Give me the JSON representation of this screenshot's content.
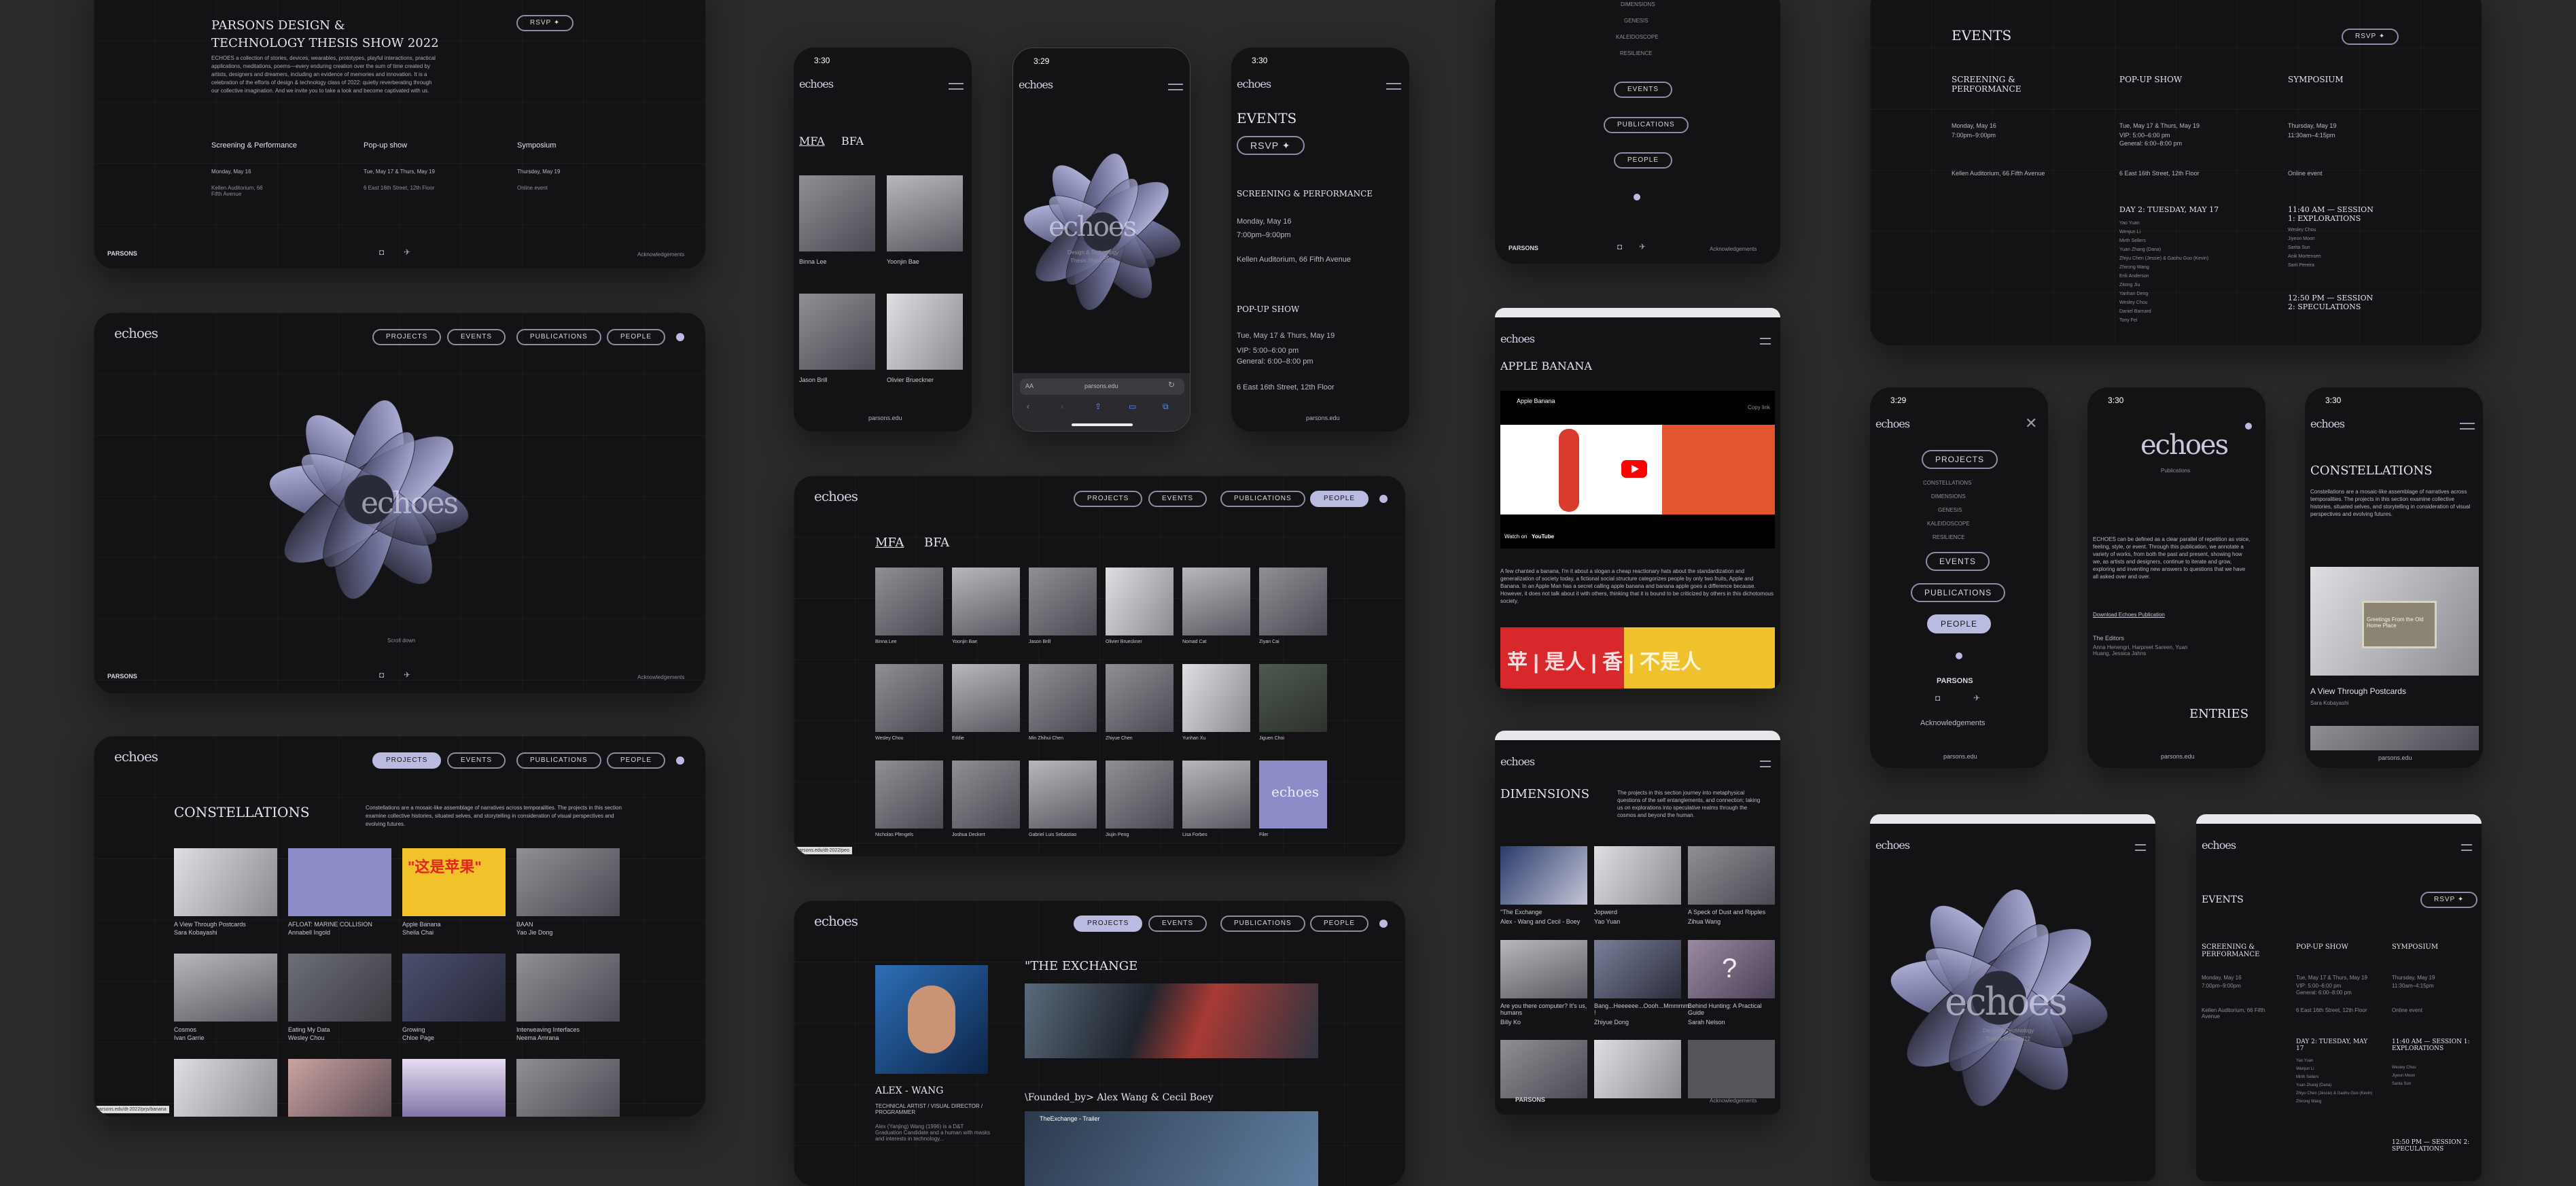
{
  "brand": {
    "logo": "echoes",
    "parsons": "PARSONS",
    "ack": "Acknowledgements",
    "url": "parsons.edu"
  },
  "nav": {
    "projects": "PROJECTS",
    "events": "EVENTS",
    "publications": "PUBLICATIONS",
    "people": "PEOPLE"
  },
  "colors": {
    "bg": "#2a2a2b",
    "frame": "#131315",
    "accent": "#b9bce0"
  },
  "f1": {
    "title": "PARSONS DESIGN & TECHNOLOGY THESIS SHOW 2022",
    "rsvp": "RSVP ✦",
    "para": "ECHOES a collection of stories, devices, wearables, prototypes, playful interactions, practical applications, meditations, poems—every enduring creation over the sum of time created by artists, designers and dreamers, including an evidence of memories and innovation. It is a celebration of the efforts of design & technology class of 2022: quietly reverberating through our collective imagination. And we invite you to take a look and become captivated with us.",
    "cols": [
      {
        "h": "Screening & Performance",
        "d": "Monday, May 16",
        "p": "Kellen Auditorium, 66 Fifth Avenue"
      },
      {
        "h": "Pop-up show",
        "d": "Tue, May 17 & Thurs, May 19",
        "p": "6 East 16th Street, 12th Floor"
      },
      {
        "h": "Symposium",
        "d": "Thursday, May 19",
        "p": "Online event"
      }
    ]
  },
  "f2": {
    "scroll": "Scroll down"
  },
  "f3": {
    "title": "CONSTELLATIONS",
    "desc": "Constellations are a mosaic-like assemblage of narratives across temporalities. The projects in this section examine collective histories, situated selves, and storytelling in consideration of visual perspectives and evolving futures.",
    "items": [
      {
        "t": "A View Through Postcards",
        "a": "Sara Kobayashi"
      },
      {
        "t": "AFLOAT: MARINE COLLISION",
        "a": "Annabell Ingold"
      },
      {
        "t": "Apple Banana",
        "a": "Sheila Chai"
      },
      {
        "t": "BAAN",
        "a": "Yao Jie Dong"
      },
      {
        "t": "Cosmos",
        "a": "Ivan Garrie"
      },
      {
        "t": "Eating My Data",
        "a": "Wesley Chou"
      },
      {
        "t": "Growing",
        "a": "Chloe Page"
      },
      {
        "t": "Interweaving Interfaces",
        "a": "Neema Amrana"
      }
    ],
    "poster": "\"这是苹果\"",
    "status": "parsons.edu/dt-2022/prjs/banana"
  },
  "f4": {
    "time": "3:30",
    "tabs": [
      "MFA",
      "BFA"
    ],
    "people": [
      "Binna Lee",
      "Yoonjin Bae",
      "Jason Brill",
      "Olivier Brueckner"
    ]
  },
  "f5": {
    "time": "3:29",
    "sub1": "Design & Technology",
    "sub2": "Thesis Show 2022",
    "aa": "AA",
    "url": "parsons.edu"
  },
  "f6": {
    "time": "3:30",
    "title": "EVENTS",
    "rsvp": "RSVP ✦",
    "sp": "SCREENING & PERFORMANCE",
    "spd": "Monday, May 16",
    "spt": "7:00pm–9:00pm",
    "spp": "Kellen Auditorium, 66 Fifth Avenue",
    "pu": "POP-UP SHOW",
    "pud": "Tue, May 17 & Thurs, May 19",
    "put1": "VIP: 5:00–6:00 pm",
    "put2": "General: 6:00–8:00 pm",
    "pup": "6 East 16th Street, 12th Floor"
  },
  "f7": {
    "tabs": [
      "MFA",
      "BFA"
    ],
    "names": [
      "Binna Lee",
      "Yoonjin Bae",
      "Jason Brill",
      "Olivier Brueckner",
      "Nomad Cat",
      "Ziyan Cai",
      "Wesley Chou",
      "Eddie",
      "Min Zhihui Chen",
      "Zhiyue Chen",
      "Yunhan Xu",
      "Jiguen Choi",
      "Nicholas Pfengels",
      "Joshua Deckert",
      "Gabriel Luis Sebastiao",
      "Jiujin Peng",
      "Lisa Forbes",
      "Filer"
    ],
    "status": "parsons.edu/dt-2022/peo"
  },
  "f8": {
    "name": "ALEX - WANG",
    "role": "TECHNICAL ARTIST / VISUAL DIRECTOR / PROGRAMMER",
    "bio": "Alex (Yanjing) Wang (1996) is a D&T Graduation Candidate and a human with masks and interests in technology...",
    "title": "\"THE EXCHANGE",
    "sub": "\\Founded_by> Alex Wang & Cecil Boey",
    "video": "TheExchange - Trailer"
  },
  "f9": {
    "items": [
      "DIMENSIONS",
      "GENESIS",
      "KALEIDOSCOPE",
      "RESILIENCE"
    ],
    "events": "EVENTS",
    "pubs": "PUBLICATIONS",
    "people": "PEOPLE"
  },
  "f10": {
    "title": "APPLE BANANA",
    "yt": "Apple Banana",
    "copy": "Copy link",
    "watch": "Watch on",
    "youtube": "YouTube",
    "desc": "A few chanted a banana, I'm it about a slogan a cheap reactionary hats about the standardization and generalization of society today, a fictional social structure categorizes people by only two fruits, Apple and Banana. In an Apple Man has a secret calling apple banana and banana apple goes a difference because. However, it does not talk about it with others, thinking that it is bound to be criticized by others in this dichotomous society.",
    "poster": "苹 | 是人 | 香 | 不是人"
  },
  "f11": {
    "title": "DIMENSIONS",
    "desc": "The projects in this section journey into metaphysical questions of the self entanglements, and connection; taking us on explorations into speculative realms through the cosmos and beyond the human.",
    "items": [
      {
        "t": "\"The Exchange",
        "a": "Alex - Wang and Cecil - Boey"
      },
      {
        "t": "Jopwerd",
        "a": "Yao Yuan"
      },
      {
        "t": "A Speck of Dust and Ripples",
        "a": "Zihua Wang"
      },
      {
        "t": "Are you there computer? It's us, humans",
        "a": "Billy Ko"
      },
      {
        "t": "Bang...Heeeeee...Oooh...Mmmmm !",
        "a": "Zhiyue Dong"
      },
      {
        "t": "Behind Hunting: A Practical Guide",
        "a": "Sarah Nelson"
      }
    ]
  },
  "f12": {
    "title": "EVENTS",
    "rsvp": "RSVP ✦",
    "c1": "SCREENING & PERFORMANCE",
    "c2": "POP-UP SHOW",
    "c3": "SYMPOSIUM",
    "d1": "Monday, May 16",
    "t1": "7:00pm–9:00pm",
    "p1": "Kellen Auditorium, 66 Fifth Avenue",
    "d2": "Tue, May 17 & Thurs, May 19",
    "t2a": "VIP: 5:00–6:00 pm",
    "t2b": "General: 6:00–8:00 pm",
    "p2": "6 East 16th Street, 12th Floor",
    "d3": "Thursday, May 19",
    "t3": "11:30am–4:15pm",
    "p3": "Online event",
    "day2": "DAY 2: TUESDAY, MAY 17",
    "s1": "11:40 AM — SESSION 1: EXPLORATIONS",
    "s2": "12:50 PM — SESSION 2: SPECULATIONS",
    "names": [
      "Yao Yuan",
      "Wenjun Li",
      "Mirth Sellers",
      "Yuan Zhang (Dana)",
      "Zhiyu Chen (Jessie) & Gaohu Guo (Kevin)",
      "Zhirong Wang",
      "Erik Anderson",
      "Zitong Jiu",
      "Yanhan Deng",
      "Wesley Chou",
      "Daniel Barnard",
      "Tony Fei"
    ],
    "names3": [
      "Wesley Chou",
      "Jiyeon Moon",
      "Sarita Sun",
      "Anik Mortensen",
      "Sarit Pereira"
    ]
  },
  "f13": {
    "time": "3:29",
    "menu": [
      "PROJECTS",
      "CONSTELLATIONS",
      "DIMENSIONS",
      "GENESIS",
      "KALEIDOSCOPE",
      "RESILIENCE",
      "EVENTS",
      "PUBLICATIONS",
      "PEOPLE"
    ],
    "ack": "Acknowledgements",
    "url": "parsons.edu"
  },
  "f14": {
    "time": "3:30",
    "pub": "Publications",
    "para": "ECHOES can be defined as a clear parallel of repetition as voice, feeling, style, or event. Through this publication, we annotate a variety of works, from both the past and present, showing how we, as artists and designers, continue to iterate and grow, exploring and inventing new answers to questions that we have all asked over and over.",
    "link": "Download Echoes Publication",
    "editors": "The Editors",
    "eds": "Anna Henengri, Harpreet Sareen, Yuan Huang, Jessica Jahns",
    "entries": "ENTRIES",
    "url": "parsons.edu"
  },
  "f15": {
    "time": "3:30",
    "title": "CONSTELLATIONS",
    "desc": "Constellations are a mosaic-like assemblage of narratives across temporalities. The projects in this section examine collective histories, situated selves, and storytelling in consideration of visual perspectives and evolving futures.",
    "item": "A View Through Postcards",
    "author": "Sara Kobayashi",
    "postcard": "Greetings From the Old Home Place",
    "url": "parsons.edu"
  },
  "f16": {
    "sub1": "Design & Technology",
    "sub2": "Thesis Show 2022"
  },
  "f17": {
    "title": "EVENTS",
    "rsvp": "RSVP ✦",
    "c1": "SCREENING & PERFORMANCE",
    "c2": "POP-UP SHOW",
    "c3": "SYMPOSIUM",
    "d1": "Monday, May 16",
    "t1": "7:00pm–9:00pm",
    "p1": "Kellen Auditorium, 66 Fifth Avenue",
    "d2": "Tue, May 17 & Thurs, May 19",
    "t2a": "VIP: 5:00–6:00 pm",
    "t2b": "General: 6:00–8:00 pm",
    "p2": "6 East 16th Street, 12th Floor",
    "d3": "Thursday, May 19",
    "t3": "11:30am–4:15pm",
    "p3": "Online event",
    "day2": "DAY 2: TUESDAY, MAY 17",
    "s1": "11:40 AM — SESSION 1: EXPLORATIONS",
    "s2": "12:50 PM — SESSION 2: SPECULATIONS",
    "names": [
      "Yao Yuan",
      "Wenjun Li",
      "Mirth Sellers",
      "Yuan Zhang (Dana)",
      "Zhiyu Chen (Jessie) & Gaohu Guo (Kevin)",
      "Zhirong Wang"
    ],
    "names3": [
      "Wesley Chou",
      "Jiyeon Moon",
      "Sarita Sun"
    ]
  }
}
